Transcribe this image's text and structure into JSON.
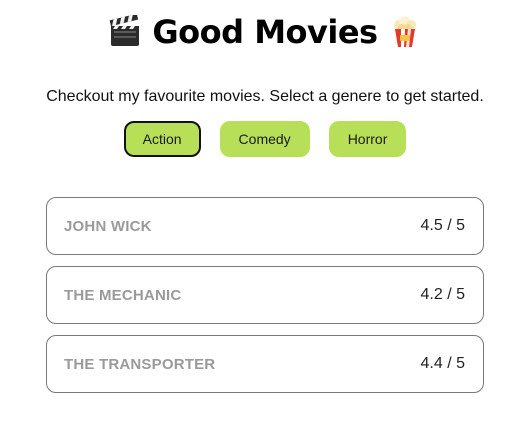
{
  "header": {
    "title": "Good Movies",
    "left_icon": "clapperboard-icon",
    "right_icon": "popcorn-icon"
  },
  "subtitle": "Checkout my favourite movies. Select a genere to get started.",
  "genres": [
    {
      "label": "Action",
      "active": true
    },
    {
      "label": "Comedy",
      "active": false
    },
    {
      "label": "Horror",
      "active": false
    }
  ],
  "movies": [
    {
      "name": "JOHN WICK",
      "rating": "4.5 / 5"
    },
    {
      "name": "THE MECHANIC",
      "rating": "4.2 / 5"
    },
    {
      "name": "THE TRANSPORTER",
      "rating": "4.4 / 5"
    }
  ],
  "colors": {
    "accent": "#b7df57",
    "active_border": "#111111",
    "movie_name": "#9a9a9a"
  }
}
